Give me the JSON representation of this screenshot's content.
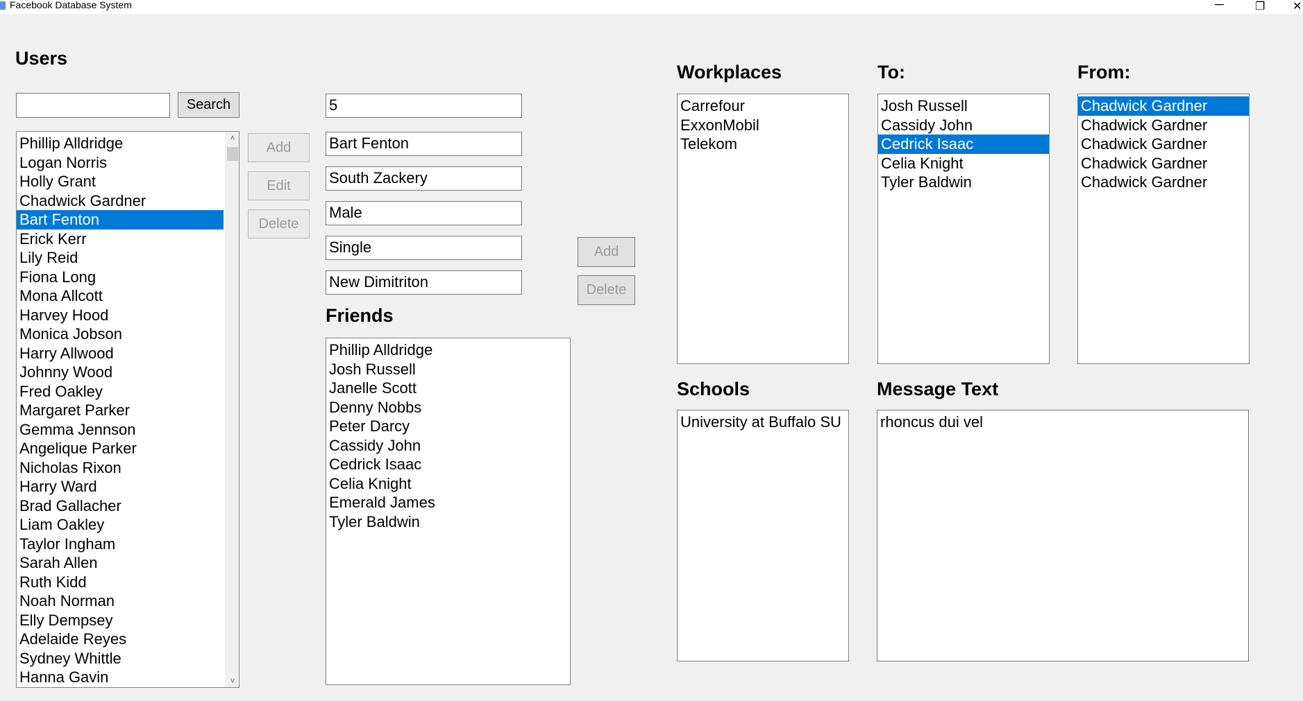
{
  "window": {
    "title": "Facebook Database System",
    "minimize_glyph": "─",
    "restore_glyph": "❐",
    "close_glyph": "✕"
  },
  "users": {
    "heading": "Users",
    "search_value": "",
    "search_label": "Search",
    "selected_index": 4,
    "items": [
      "Phillip Alldridge",
      "Logan Norris",
      "Holly Grant",
      "Chadwick Gardner",
      "Bart Fenton",
      "Erick Kerr",
      "Lily Reid",
      "Fiona Long",
      "Mona Allcott",
      "Harvey Hood",
      "Monica Jobson",
      "Harry Allwood",
      "Johnny Wood",
      "Fred Oakley",
      "Margaret Parker",
      "Gemma Jennson",
      "Angelique Parker",
      "Nicholas Rixon",
      "Harry Ward",
      "Brad Gallacher",
      "Liam Oakley",
      "Taylor Ingham",
      "Sarah Allen",
      "Ruth Kidd",
      "Noah Norman",
      "Elly Dempsey",
      "Adelaide Reyes",
      "Sydney Whittle",
      "Hanna Gavin"
    ],
    "scroll_up": "˄",
    "scroll_down": "˅"
  },
  "user_buttons": {
    "add": "Add",
    "edit": "Edit",
    "delete": "Delete"
  },
  "details": {
    "id": "5",
    "name": "Bart Fenton",
    "city": "South Zackery",
    "gender": "Male",
    "status": "Single",
    "hometown": "New Dimitriton"
  },
  "friends": {
    "heading": "Friends",
    "items": [
      "Phillip Alldridge",
      "Josh Russell",
      "Janelle Scott",
      "Denny Nobbs",
      "Peter Darcy",
      "Cassidy John",
      "Cedrick Isaac",
      "Celia Knight",
      "Emerald James",
      "Tyler Baldwin"
    ]
  },
  "friend_buttons": {
    "add": "Add",
    "delete": "Delete"
  },
  "workplaces": {
    "heading": "Workplaces",
    "items": [
      "Carrefour",
      "ExxonMobil",
      "Telekom"
    ]
  },
  "to": {
    "heading": "To:",
    "selected_index": 2,
    "items": [
      "Josh Russell",
      "Cassidy John",
      "Cedrick Isaac",
      "Celia Knight",
      "Tyler Baldwin"
    ]
  },
  "from": {
    "heading": "From:",
    "selected_index": 0,
    "items": [
      "Chadwick Gardner",
      "Chadwick Gardner",
      "Chadwick Gardner",
      "Chadwick Gardner",
      "Chadwick Gardner"
    ]
  },
  "schools": {
    "heading": "Schools",
    "items": [
      "University at Buffalo SU"
    ]
  },
  "message": {
    "heading": "Message Text",
    "text": "rhoncus dui vel"
  },
  "colors": {
    "selection": "#0078d7",
    "background": "#f0f0f0"
  }
}
